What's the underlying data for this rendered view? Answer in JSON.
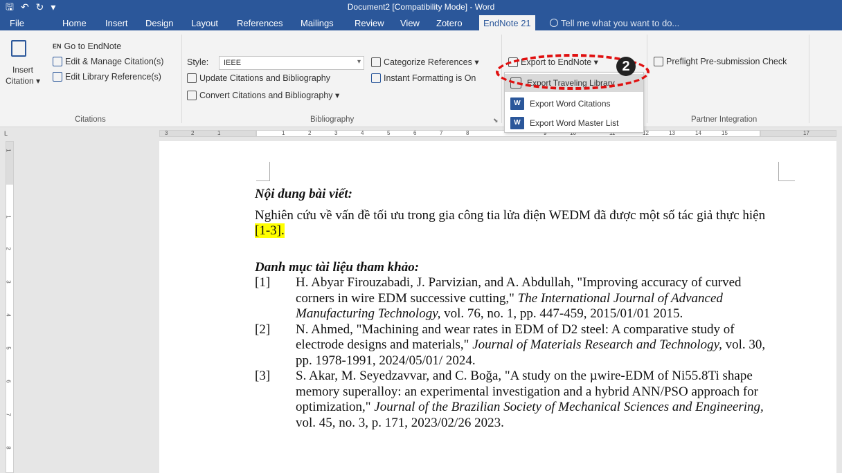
{
  "window": {
    "title": "Document2 [Compatibility Mode] - Word"
  },
  "qat": {
    "save_icon": "save-icon",
    "undo_icon": "undo-icon",
    "redo_icon": "redo-icon",
    "customize": "▾"
  },
  "tabs": [
    {
      "label": "File"
    },
    {
      "label": "Home"
    },
    {
      "label": "Insert"
    },
    {
      "label": "Design"
    },
    {
      "label": "Layout"
    },
    {
      "label": "References"
    },
    {
      "label": "Mailings"
    },
    {
      "label": "Review"
    },
    {
      "label": "View"
    },
    {
      "label": "Zotero"
    },
    {
      "label": "EndNote 21"
    }
  ],
  "tellme": "Tell me what you want to do...",
  "ribbon": {
    "citations": {
      "insert_label": "Insert",
      "citation_label": "Citation ▾",
      "goto": "Go to EndNote",
      "edit_manage": "Edit & Manage Citation(s)",
      "edit_library": "Edit Library Reference(s)",
      "group": "Citations"
    },
    "bibliography": {
      "style_label": "Style:",
      "style_value": "IEEE",
      "update": "Update Citations and Bibliography",
      "convert": "Convert Citations and Bibliography ▾",
      "categorize": "Categorize References ▾",
      "instant": "Instant Formatting is On",
      "group": "Bibliography"
    },
    "export": {
      "label": "Export to EndNote ▾"
    },
    "partner": {
      "preflight": "Preflight Pre-submission Check",
      "group": "Partner Integration"
    }
  },
  "dropdown": [
    {
      "label": "Export Traveling Library",
      "highlighted": true
    },
    {
      "label": "Export Word Citations",
      "highlighted": false
    },
    {
      "label": "Export Word Master List",
      "highlighted": false
    }
  ],
  "annotation": {
    "badge": "2"
  },
  "ruler": {
    "labels_left": [
      "3",
      "2",
      "1"
    ],
    "labels_right": [
      "1",
      "2",
      "3",
      "4",
      "5",
      "6",
      "7",
      "8",
      "9",
      "10",
      "11",
      "12",
      "13",
      "14",
      "15",
      "17"
    ],
    "vertical": [
      "1",
      "1",
      "2",
      "3",
      "4",
      "5",
      "6",
      "7",
      "8"
    ]
  },
  "document": {
    "heading1": "Nội dung bài viết:",
    "para_before": "Nghiên cứu về vấn đề tối ưu trong gia công tia lửa điện WEDM đã được một số tác giả thực hiện ",
    "para_cite": "[1-3].",
    "heading2": "Danh mục tài liệu tham khảo:",
    "refs": [
      {
        "num": "[1]",
        "text": "H. Abyar Firouzabadi, J. Parvizian, and A. Abdullah, \"Improving accuracy of curved corners in wire EDM successive cutting,\" ",
        "journal": "The International Journal of Advanced Manufacturing Technology,",
        "tail": " vol. 76, no. 1, pp. 447-459, 2015/01/01 2015."
      },
      {
        "num": "[2]",
        "text": "N. Ahmed, \"Machining and wear rates in EDM of D2 steel: A comparative study of electrode designs and materials,\" ",
        "journal": "Journal of Materials Research and Technology,",
        "tail": " vol. 30, pp. 1978-1991, 2024/05/01/ 2024."
      },
      {
        "num": "[3]",
        "text": "S. Akar, M. Seyedzavvar, and C. Boğa, \"A study on the µwire-EDM of Ni55.8Ti shape memory superalloy: an experimental investigation and a hybrid ANN/PSO approach for optimization,\" ",
        "journal": "Journal of the Brazilian Society of Mechanical Sciences and Engineering,",
        "tail": " vol. 45, no. 3, p. 171, 2023/02/26 2023."
      }
    ]
  }
}
